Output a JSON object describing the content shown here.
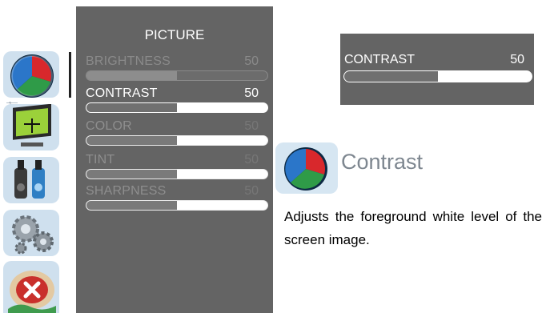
{
  "menu": {
    "title": "PICTURE",
    "items": [
      {
        "label": "BRIGHTNESS",
        "value": "50",
        "level": 0.5
      },
      {
        "label": "CONTRAST",
        "value": "50",
        "level": 0.5
      },
      {
        "label": "COLOR",
        "value": "50",
        "level": 0.5
      },
      {
        "label": "TINT",
        "value": "50",
        "level": 0.5
      },
      {
        "label": "SHARPNESS",
        "value": "50",
        "level": 0.5
      }
    ]
  },
  "sidebar": {
    "tick_label": "1",
    "icons": [
      "picture-color-wheel-icon",
      "screen-position-icon",
      "audio-speakers-icon",
      "settings-gears-icon",
      "exit-icon"
    ]
  },
  "preview": {
    "label": "CONTRAST",
    "value": "50",
    "level": 0.5
  },
  "help": {
    "title": "Contrast",
    "description": "Adjusts the foreground white level of the screen image."
  }
}
